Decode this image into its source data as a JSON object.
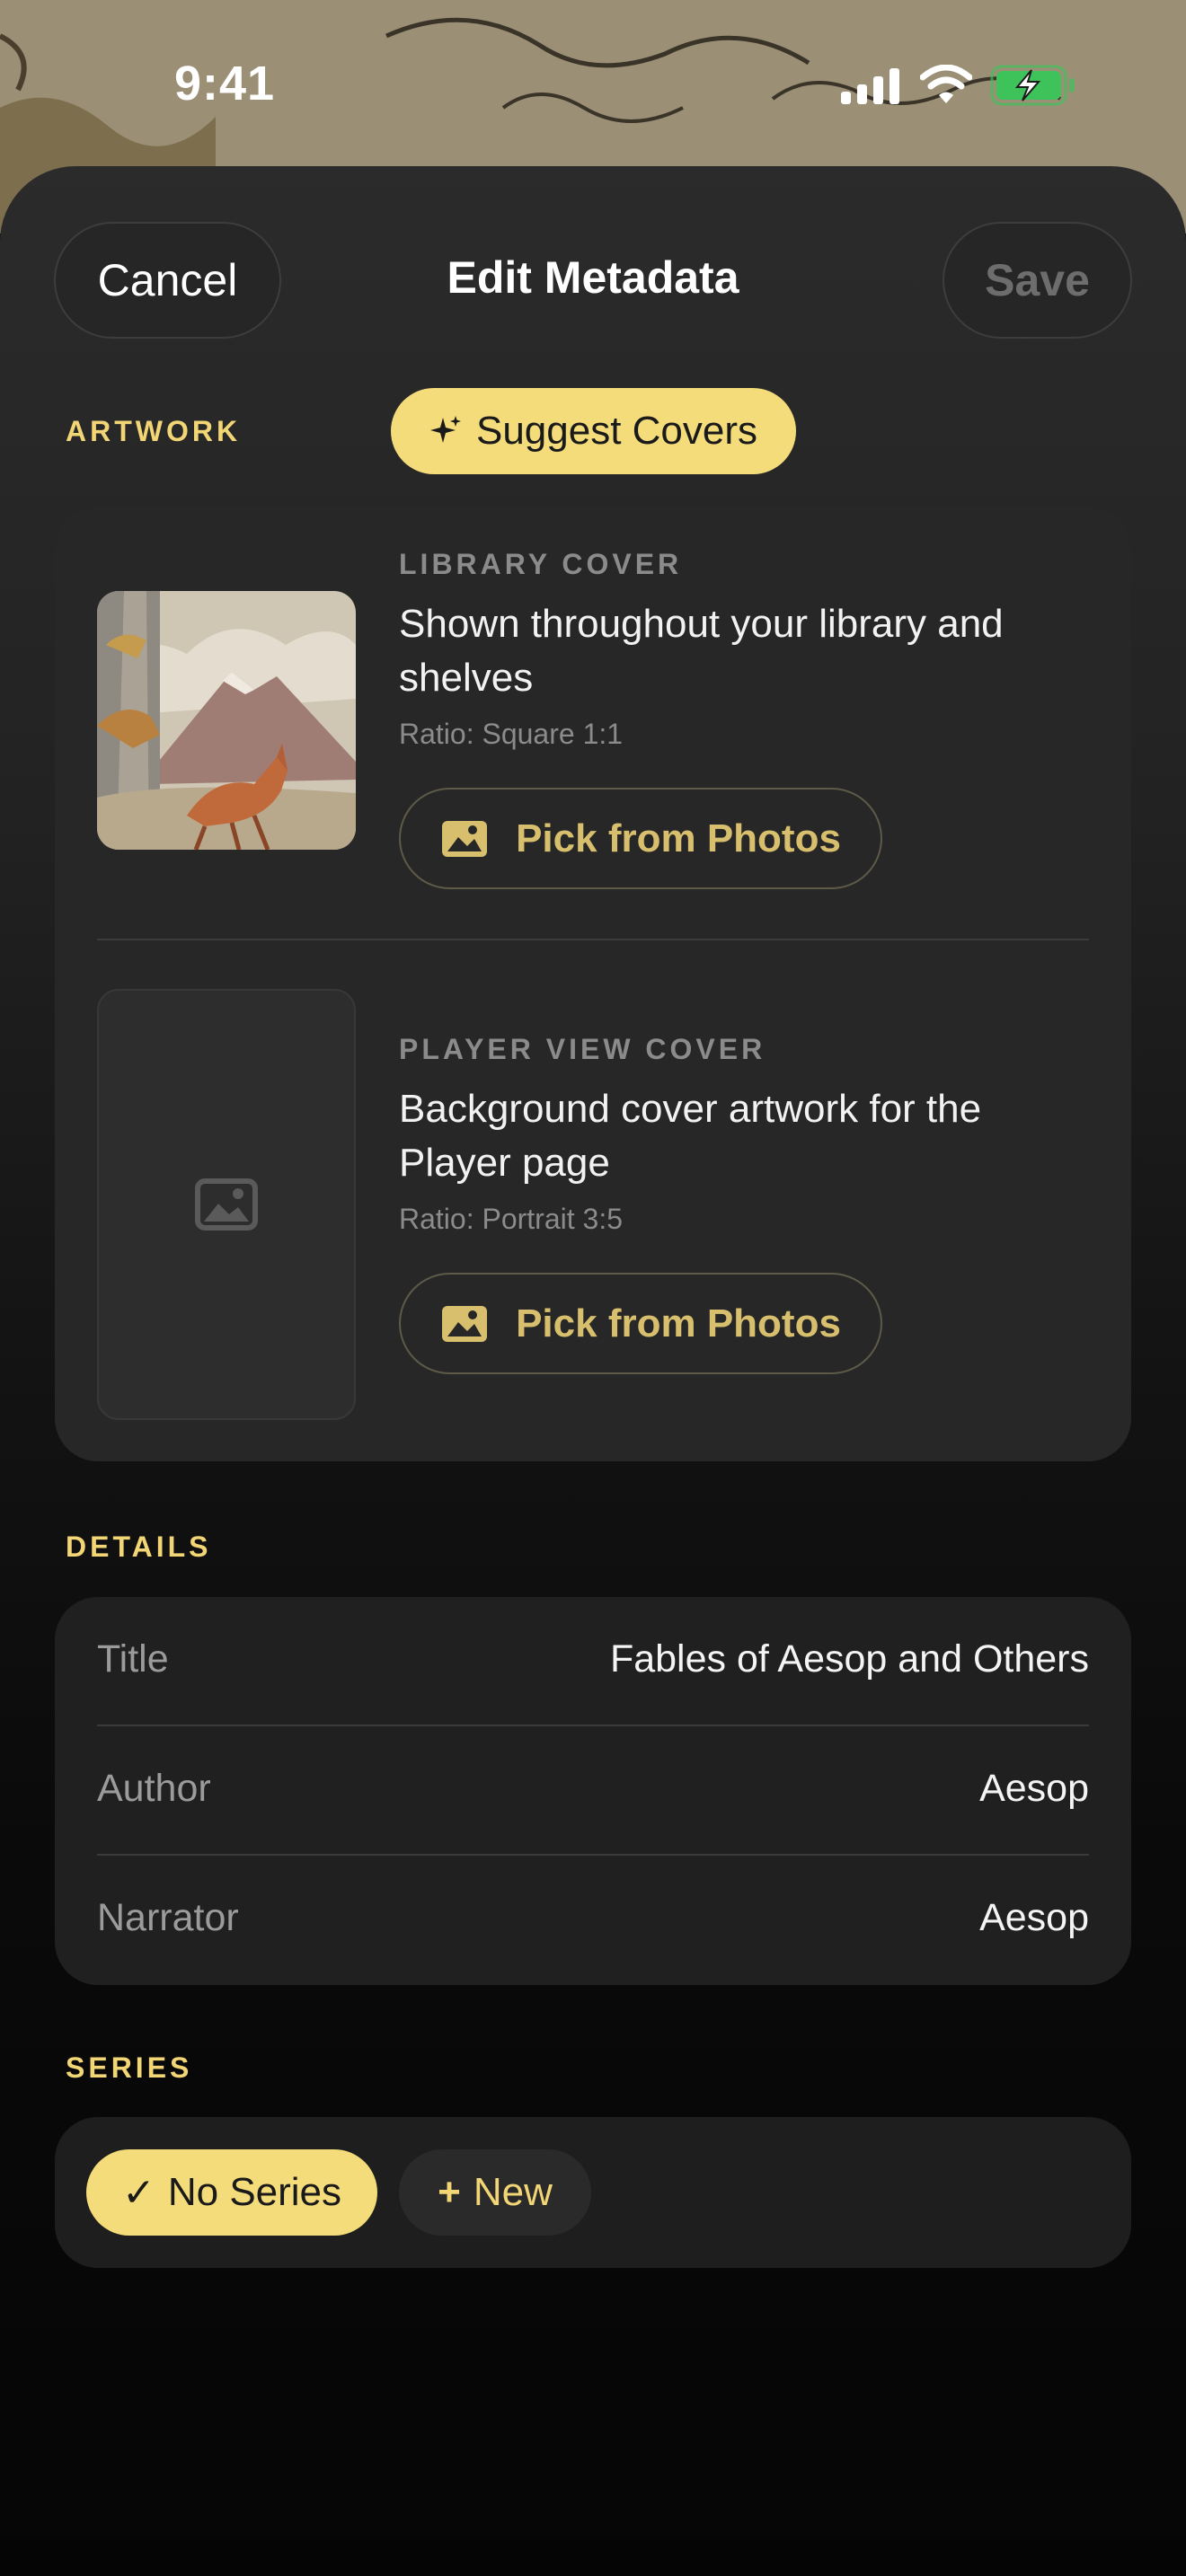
{
  "status_bar": {
    "time": "9:41"
  },
  "nav": {
    "cancel_label": "Cancel",
    "title": "Edit Metadata",
    "save_label": "Save"
  },
  "artwork": {
    "section_label": "ARTWORK",
    "suggest_label": "Suggest Covers",
    "library_cover": {
      "kicker": "LIBRARY COVER",
      "description": "Shown throughout your library and shelves",
      "ratio": "Ratio: Square 1:1",
      "pick_label": "Pick from Photos"
    },
    "player_cover": {
      "kicker": "PLAYER VIEW COVER",
      "description": "Background cover artwork for the Player page",
      "ratio": "Ratio: Portrait 3:5",
      "pick_label": "Pick from Photos"
    }
  },
  "details": {
    "section_label": "DETAILS",
    "rows": [
      {
        "label": "Title",
        "value": "Fables of Aesop and Others"
      },
      {
        "label": "Author",
        "value": "Aesop"
      },
      {
        "label": "Narrator",
        "value": "Aesop"
      }
    ]
  },
  "series": {
    "section_label": "SERIES",
    "selected_label": "No Series",
    "new_label": "New"
  },
  "colors": {
    "accent": "#f5dc7a",
    "accent_text": "#f2d574",
    "battery_green": "#3ec25a"
  }
}
